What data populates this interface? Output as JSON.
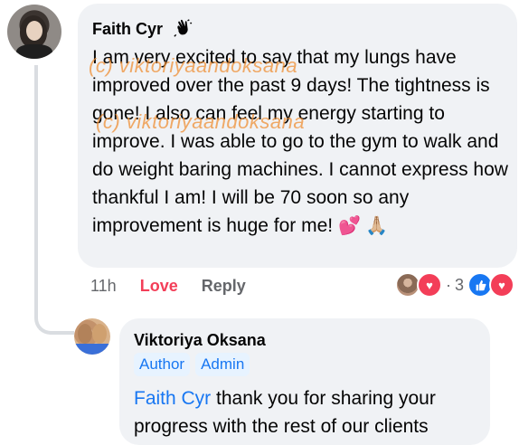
{
  "comment": {
    "author": "Faith Cyr",
    "badge_icon": "waving-hand-icon",
    "text": "I am very excited to say that my lungs have improved over the past 9 days! The tightness is gone! I also can feel my energy starting to improve. I was able to go to the gym to walk and do weight baring machines. I cannot express how thankful I am! I will be 70 soon so any improvement is huge for me!",
    "emoji": "💕 🙏🏼",
    "time": "11h",
    "love_label": "Love",
    "reply_label": "Reply",
    "reaction_count": "3",
    "reaction_separator": "·"
  },
  "watermarks": [
    "(c) viktoriyaandoksana",
    "(c) viktoriyaandoksana"
  ],
  "reply": {
    "author": "Viktoriya Oksana",
    "badges": [
      "Author",
      "Admin"
    ],
    "mention": "Faith Cyr",
    "text": " thank you for sharing your progress with the rest of our clients"
  },
  "colors": {
    "bubble": "#f0f2f5",
    "love": "#f33e58",
    "link": "#1877f2",
    "muted": "#65676b",
    "watermark": "#ef8f34"
  }
}
